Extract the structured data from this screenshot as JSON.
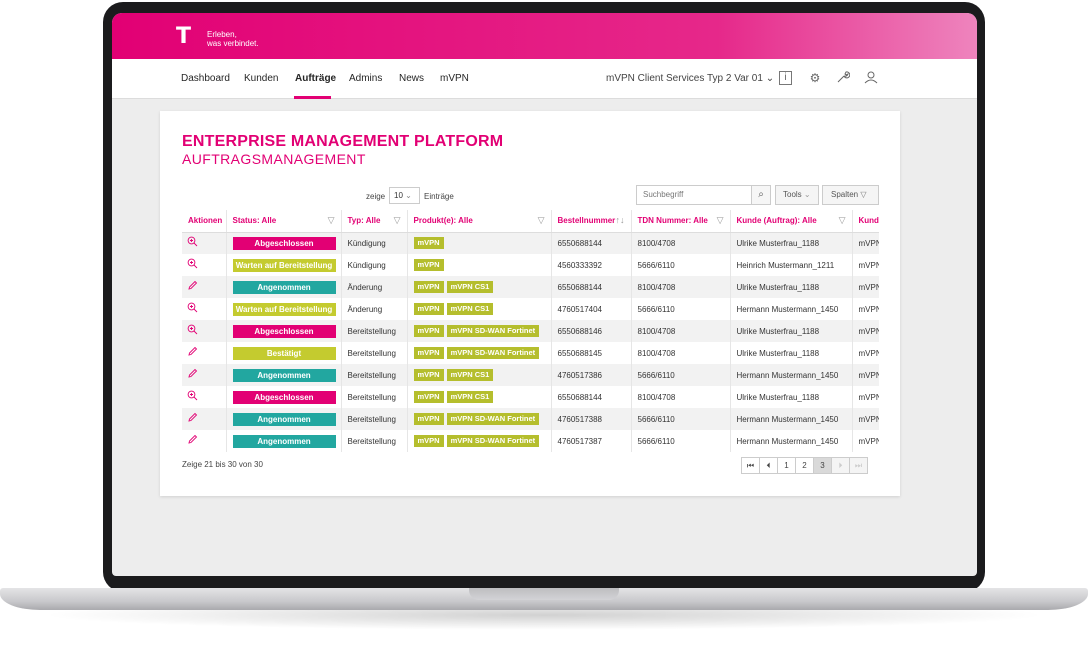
{
  "brand": {
    "logo": "T",
    "slogan_line1": "Erleben,",
    "slogan_line2": "was verbindet."
  },
  "nav": {
    "items": [
      "Dashboard",
      "Kunden",
      "Aufträge",
      "Admins",
      "News",
      "mVPN"
    ],
    "active": "Aufträge",
    "context": "mVPN Client Services Typ 2 Var 01",
    "info_label": "i"
  },
  "page": {
    "title": "ENTERPRISE MANAGEMENT PLATFORM",
    "subtitle": "AUFTRAGSMANAGEMENT"
  },
  "controls": {
    "show_prefix": "zeige",
    "page_size": "10",
    "show_suffix": "Einträge",
    "search_placeholder": "Suchbegriff",
    "tools_label": "Tools",
    "columns_label": "Spalten"
  },
  "table": {
    "headers": [
      "Aktionen",
      "Status: Alle",
      "Typ: Alle",
      "Produkt(e): Alle",
      "Bestellnummer",
      "TDN Nummer: Alle",
      "Kunde (Auftrag): Alle",
      "Kunde"
    ],
    "rows": [
      {
        "action": "view",
        "status": "Abgeschlossen",
        "type": "Kündigung",
        "products": [
          "mVPN"
        ],
        "order": "6550688144",
        "tdn": "8100/4708",
        "customer": "Ulrike Musterfrau_1188",
        "customer2": "mVPN"
      },
      {
        "action": "view",
        "status": "Warten auf Bereitstellung",
        "type": "Kündigung",
        "products": [
          "mVPN"
        ],
        "order": "4560333392",
        "tdn": "5666/6110",
        "customer": "Heinrich Mustermann_1211",
        "customer2": "mVPN"
      },
      {
        "action": "edit",
        "status": "Angenommen",
        "type": "Änderung",
        "products": [
          "mVPN",
          "mVPN CS1"
        ],
        "order": "6550688144",
        "tdn": "8100/4708",
        "customer": "Ulrike Musterfrau_1188",
        "customer2": "mVPN"
      },
      {
        "action": "view",
        "status": "Warten auf Bereitstellung",
        "type": "Änderung",
        "products": [
          "mVPN",
          "mVPN CS1"
        ],
        "order": "4760517404",
        "tdn": "5666/6110",
        "customer": "Hermann Mustermann_1450",
        "customer2": "mVPN"
      },
      {
        "action": "view",
        "status": "Abgeschlossen",
        "type": "Bereitstellung",
        "products": [
          "mVPN",
          "mVPN SD-WAN Fortinet"
        ],
        "order": "6550688146",
        "tdn": "8100/4708",
        "customer": "Ulrike Musterfrau_1188",
        "customer2": "mVPN"
      },
      {
        "action": "edit",
        "status": "Bestätigt",
        "type": "Bereitstellung",
        "products": [
          "mVPN",
          "mVPN SD-WAN Fortinet"
        ],
        "order": "6550688145",
        "tdn": "8100/4708",
        "customer": "Ulrike Musterfrau_1188",
        "customer2": "mVPN"
      },
      {
        "action": "edit",
        "status": "Angenommen",
        "type": "Bereitstellung",
        "products": [
          "mVPN",
          "mVPN CS1"
        ],
        "order": "4760517386",
        "tdn": "5666/6110",
        "customer": "Hermann Mustermann_1450",
        "customer2": "mVPN"
      },
      {
        "action": "view",
        "status": "Abgeschlossen",
        "type": "Bereitstellung",
        "products": [
          "mVPN",
          "mVPN CS1"
        ],
        "order": "6550688144",
        "tdn": "8100/4708",
        "customer": "Ulrike Musterfrau_1188",
        "customer2": "mVPN"
      },
      {
        "action": "edit",
        "status": "Angenommen",
        "type": "Bereitstellung",
        "products": [
          "mVPN",
          "mVPN SD-WAN Fortinet"
        ],
        "order": "4760517388",
        "tdn": "5666/6110",
        "customer": "Hermann Mustermann_1450",
        "customer2": "mVPN"
      },
      {
        "action": "edit",
        "status": "Angenommen",
        "type": "Bereitstellung",
        "products": [
          "mVPN",
          "mVPN SD-WAN Fortinet"
        ],
        "order": "4760517387",
        "tdn": "5666/6110",
        "customer": "Hermann Mustermann_1450",
        "customer2": "mVPN"
      }
    ]
  },
  "status_colors": {
    "Abgeschlossen": "#e20074",
    "Warten auf Bereitstellung": "#c4cb2f",
    "Angenommen": "#22a7a0",
    "Bestätigt": "#c4cb2f"
  },
  "product_color": "#b5be2d",
  "footer": {
    "summary": "Zeige 21 bis 30 von 30",
    "pages": [
      "1",
      "2",
      "3"
    ],
    "current_page": "3"
  }
}
